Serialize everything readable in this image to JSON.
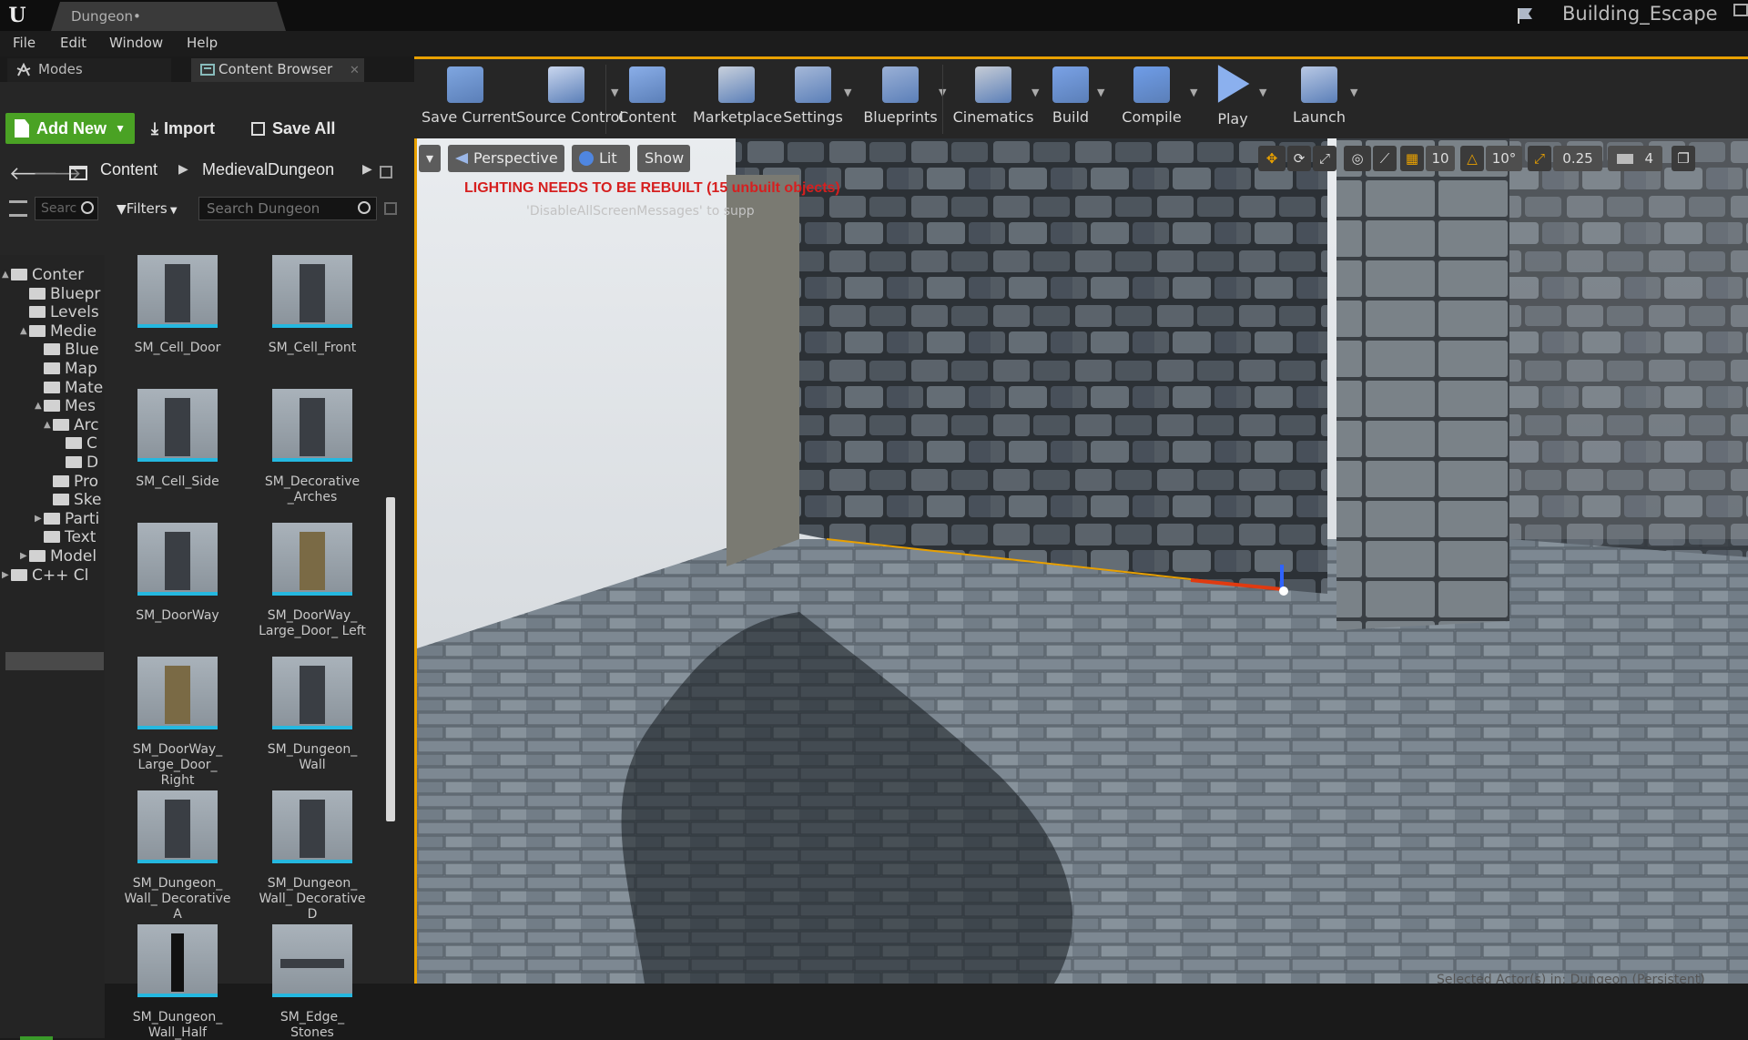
{
  "window": {
    "doc_tab": "Dungeon•",
    "project_name": "Building_Escape"
  },
  "menu": [
    "File",
    "Edit",
    "Window",
    "Help"
  ],
  "panel_tabs": {
    "modes": "Modes",
    "content_browser": "Content Browser"
  },
  "cb_toolbar": {
    "add_new": "Add New",
    "import": "Import",
    "save_all": "Save All"
  },
  "breadcrumb": [
    "Content",
    "MedievalDungeon"
  ],
  "search": {
    "tree_placeholder": "Searc",
    "filters": "Filters",
    "assets_placeholder": "Search Dungeon"
  },
  "tree": [
    {
      "label": "Conter",
      "level": 0,
      "arrow": "▲"
    },
    {
      "label": "Bluepr",
      "level": 1,
      "arrow": ""
    },
    {
      "label": "Levels",
      "level": 1,
      "arrow": ""
    },
    {
      "label": "Medie",
      "level": 1,
      "arrow": "▲"
    },
    {
      "label": "Blue",
      "level": 2,
      "arrow": ""
    },
    {
      "label": "Map",
      "level": 2,
      "arrow": ""
    },
    {
      "label": "Mate",
      "level": 2,
      "arrow": ""
    },
    {
      "label": "Mes",
      "level": 2,
      "arrow": "▲"
    },
    {
      "label": "Arc",
      "level": 3,
      "arrow": "▲"
    },
    {
      "label": "C",
      "level": 4,
      "arrow": ""
    },
    {
      "label": "D",
      "level": 4,
      "arrow": ""
    },
    {
      "label": "Pro",
      "level": 3,
      "arrow": ""
    },
    {
      "label": "Ske",
      "level": 3,
      "arrow": ""
    },
    {
      "label": "Parti",
      "level": 2,
      "arrow": "▶"
    },
    {
      "label": "Text",
      "level": 2,
      "arrow": ""
    },
    {
      "label": "Model",
      "level": 1,
      "arrow": "▶"
    },
    {
      "label": "C++ Cl",
      "level": 0,
      "arrow": "▶"
    }
  ],
  "assets": [
    {
      "name": "SM_Cell_Door"
    },
    {
      "name": "SM_Cell_Front"
    },
    {
      "name": "SM_Cell_Side"
    },
    {
      "name": "SM_Decorative _Arches"
    },
    {
      "name": "SM_DoorWay"
    },
    {
      "name": "SM_DoorWay_ Large_Door_ Left"
    },
    {
      "name": "SM_DoorWay_ Large_Door_ Right"
    },
    {
      "name": "SM_Dungeon_ Wall"
    },
    {
      "name": "SM_Dungeon_ Wall_ Decorative A"
    },
    {
      "name": "SM_Dungeon_ Wall_ Decorative D"
    },
    {
      "name": "SM_Dungeon_ Wall_Half"
    },
    {
      "name": "SM_Edge_ Stones"
    }
  ],
  "toolbar": [
    {
      "label": "Save Current",
      "icon": "save-icon"
    },
    {
      "label": "Source Control",
      "icon": "source-control-icon"
    },
    {
      "label": "Content",
      "icon": "content-icon"
    },
    {
      "label": "Marketplace",
      "icon": "marketplace-icon"
    },
    {
      "label": "Settings",
      "icon": "settings-icon"
    },
    {
      "label": "Blueprints",
      "icon": "blueprints-icon"
    },
    {
      "label": "Cinematics",
      "icon": "cinematics-icon"
    },
    {
      "label": "Build",
      "icon": "build-icon"
    },
    {
      "label": "Compile",
      "icon": "compile-icon"
    },
    {
      "label": "Play",
      "icon": "play-icon"
    },
    {
      "label": "Launch",
      "icon": "launch-icon"
    }
  ],
  "viewport": {
    "perspective": "Perspective",
    "lit": "Lit",
    "show": "Show",
    "lighting_warning": "LIGHTING NEEDS TO BE REBUILT (15 unbuilt objects)",
    "disable_msg": "'DisableAllScreenMessages' to supp",
    "grid_snap": "10",
    "rotation_snap": "10°",
    "scale_snap": "0.25",
    "camera_speed": "4",
    "status": "Selected Actor(s) in: Dungeon (Persistent)"
  },
  "colors": {
    "accent": "#e8a000",
    "add_new": "#4aa224",
    "warning": "#d61f1f",
    "thumb_underline": "#25b8e0"
  }
}
